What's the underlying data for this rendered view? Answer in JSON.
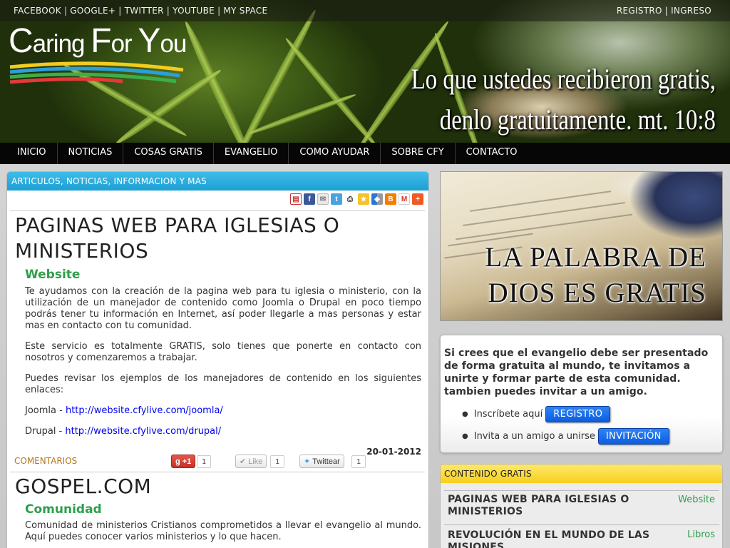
{
  "header": {
    "social_links": [
      "FACEBOOK",
      "GOOGLE+",
      "TWITTER",
      "YOUTUBE",
      "MY SPACE"
    ],
    "account_links": [
      "REGISTRO",
      "INGRESO"
    ],
    "logo": {
      "part1": "C",
      "part2": "aring ",
      "part3": "F",
      "part4": "or ",
      "part5": "Y",
      "part6": "ou"
    },
    "slogan_line1": "Lo que ustedes recibieron gratis,",
    "slogan_line2": "denlo gratuitamente. mt. 10:8"
  },
  "nav": {
    "items": [
      "INICIO",
      "NOTICIAS",
      "COSAS GRATIS",
      "EVANGELIO",
      "COMO AYUDAR",
      "SOBRE CFY",
      "CONTACTO"
    ]
  },
  "main": {
    "section_title": "ARTICULOS, NOTICIAS, INFORMACION Y MAS",
    "share_icons": [
      "pdf-icon",
      "facebook-icon",
      "email-icon",
      "twitter-icon",
      "print-icon",
      "favorite-icon",
      "delicious-icon",
      "blogger-icon",
      "gmail-icon",
      "addthis-icon"
    ],
    "article1": {
      "title": "PAGINAS WEB PARA IGLESIAS O MINISTERIOS",
      "subtitle": "Website",
      "paragraph1": "Te ayudamos con la creación de la pagina web para tu iglesia o ministerio, con la utilización de un manejador de contenido como Joomla o Drupal en poco tiempo podrás tener tu información en Internet, así poder llegarle a mas personas y estar mas en contacto con tu comunidad.",
      "paragraph2": "Este servicio es totalmente GRATIS, solo tienes que ponerte en contacto con nosotros y comenzaremos a trabajar.",
      "paragraph3": "Puedes revisar los ejemplos de los manejadores de contenido en los siguientes enlaces:",
      "joomla_label": "Joomla - ",
      "joomla_url": "http://website.cfylive.com/joomla/",
      "drupal_label": "Drupal - ",
      "drupal_url": "http://website.cfylive.com/drupal/ ",
      "date": "20-01-2012",
      "comments_label": "COMENTARIOS",
      "gplus_label": "+1",
      "gplus_count": "1",
      "like_label": "Like",
      "like_count": "1",
      "tweet_label": "Twittear",
      "tweet_count": "1"
    },
    "article2": {
      "title": "GOSPEL.COM",
      "subtitle": "Comunidad",
      "paragraph1": "Comunidad de ministerios Cristianos comprometidos a llevar el evangelio al mundo. Aquí puedes conocer varios ministerios y lo que hacen."
    }
  },
  "sidebar": {
    "banner_line1": "LA PALABRA DE",
    "banner_line2": "DIOS ES GRATIS",
    "invite_text": "Si crees que el evangelio debe ser presentado de forma gratuita al mundo, te invitamos a unirte y formar parte de esta comunidad. tambien puedes invitar a un amigo.",
    "register_text": "Inscríbete aquí",
    "register_button": "REGISTRO",
    "invite_friend_text": "Invita a un amigo a unirse",
    "invite_button": "INVITACIÓN",
    "free_title": "CONTENIDO GRATIS",
    "free_items": [
      {
        "title": "PAGINAS WEB PARA IGLESIAS O MINISTERIOS",
        "tag": "Website"
      },
      {
        "title": "REVOLUCIÓN EN EL MUNDO DE LAS MISIONES",
        "tag": "Libros"
      }
    ]
  },
  "colors": {
    "section_header_blue": "#1d9fd3",
    "free_header_yellow": "#f8cf1d",
    "subtitle_green": "#2f9e4c",
    "button_blue": "#0b5ee0",
    "nav_bg": "#060606"
  }
}
